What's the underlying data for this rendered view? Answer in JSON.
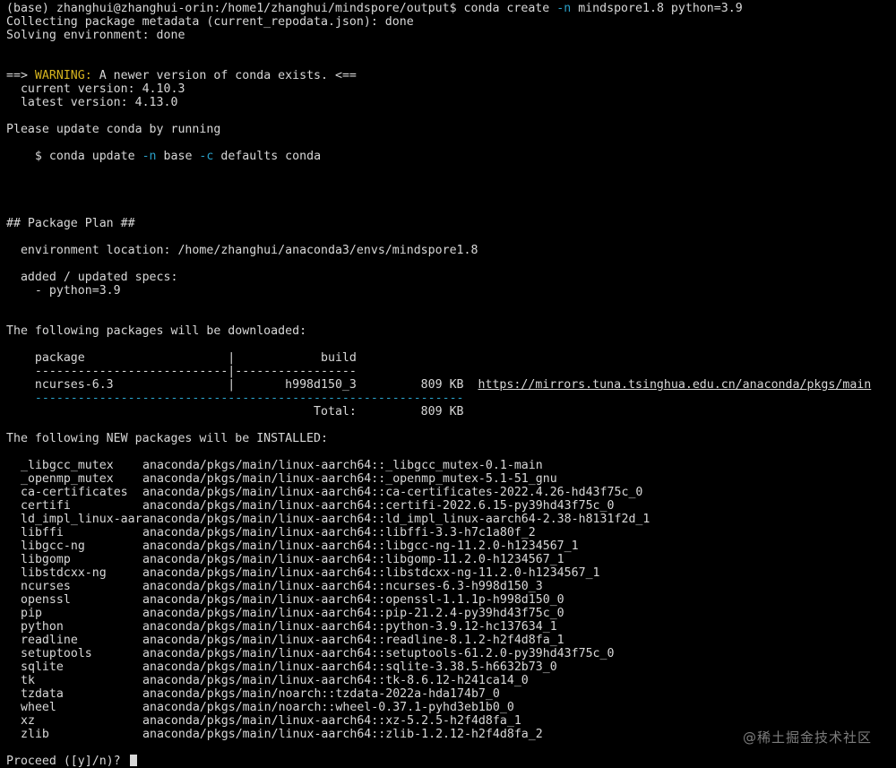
{
  "prompt": {
    "prefix": "(base) zhanghui@zhanghui-orin:/home1/zhanghui/mindspore/output$ conda create ",
    "flag_n": "-n",
    "args": " mindspore1.8 python=3.9"
  },
  "status_lines": [
    "Collecting package metadata (current_repodata.json): done",
    "Solving environment: done"
  ],
  "warning": {
    "arrow_open": "==> ",
    "label": "WARNING:",
    "text": " A newer version of conda exists. <==",
    "current_version": "  current version: 4.10.3",
    "latest_version": "  latest version: 4.13.0"
  },
  "update": {
    "please": "Please update conda by running",
    "cmd_pre": "    $ conda update ",
    "flag_n": "-n",
    "cmd_mid": " base ",
    "flag_c": "-c",
    "cmd_post": " defaults conda"
  },
  "plan": {
    "heading": "## Package Plan ##",
    "env_location": "  environment location: /home/zhanghui/anaconda3/envs/mindspore1.8",
    "specs_label": "  added / updated specs:",
    "spec_item": "    - python=3.9"
  },
  "download": {
    "heading": "The following packages will be downloaded:",
    "header": "    package                    |            build",
    "rule": "    ---------------------------|-----------------",
    "row_name": "    ncurses-6.3                |       h998d150_3         809 KB  ",
    "row_url": "https://mirrors.tuna.tsinghua.edu.cn/anaconda/pkgs/main",
    "rule2": "    ------------------------------------------------------------",
    "total": "                                           Total:         809 KB"
  },
  "install": {
    "heading": "The following NEW packages will be INSTALLED:",
    "packages": [
      {
        "name": "_libgcc_mutex",
        "spec": "anaconda/pkgs/main/linux-aarch64::_libgcc_mutex-0.1-main"
      },
      {
        "name": "_openmp_mutex",
        "spec": "anaconda/pkgs/main/linux-aarch64::_openmp_mutex-5.1-51_gnu"
      },
      {
        "name": "ca-certificates",
        "spec": "anaconda/pkgs/main/linux-aarch64::ca-certificates-2022.4.26-hd43f75c_0"
      },
      {
        "name": "certifi",
        "spec": "anaconda/pkgs/main/linux-aarch64::certifi-2022.6.15-py39hd43f75c_0"
      },
      {
        "name": "ld_impl_linux-aar~",
        "spec": "anaconda/pkgs/main/linux-aarch64::ld_impl_linux-aarch64-2.38-h8131f2d_1"
      },
      {
        "name": "libffi",
        "spec": "anaconda/pkgs/main/linux-aarch64::libffi-3.3-h7c1a80f_2"
      },
      {
        "name": "libgcc-ng",
        "spec": "anaconda/pkgs/main/linux-aarch64::libgcc-ng-11.2.0-h1234567_1"
      },
      {
        "name": "libgomp",
        "spec": "anaconda/pkgs/main/linux-aarch64::libgomp-11.2.0-h1234567_1"
      },
      {
        "name": "libstdcxx-ng",
        "spec": "anaconda/pkgs/main/linux-aarch64::libstdcxx-ng-11.2.0-h1234567_1"
      },
      {
        "name": "ncurses",
        "spec": "anaconda/pkgs/main/linux-aarch64::ncurses-6.3-h998d150_3"
      },
      {
        "name": "openssl",
        "spec": "anaconda/pkgs/main/linux-aarch64::openssl-1.1.1p-h998d150_0"
      },
      {
        "name": "pip",
        "spec": "anaconda/pkgs/main/linux-aarch64::pip-21.2.4-py39hd43f75c_0"
      },
      {
        "name": "python",
        "spec": "anaconda/pkgs/main/linux-aarch64::python-3.9.12-hc137634_1"
      },
      {
        "name": "readline",
        "spec": "anaconda/pkgs/main/linux-aarch64::readline-8.1.2-h2f4d8fa_1"
      },
      {
        "name": "setuptools",
        "spec": "anaconda/pkgs/main/linux-aarch64::setuptools-61.2.0-py39hd43f75c_0"
      },
      {
        "name": "sqlite",
        "spec": "anaconda/pkgs/main/linux-aarch64::sqlite-3.38.5-h6632b73_0"
      },
      {
        "name": "tk",
        "spec": "anaconda/pkgs/main/linux-aarch64::tk-8.6.12-h241ca14_0"
      },
      {
        "name": "tzdata",
        "spec": "anaconda/pkgs/main/noarch::tzdata-2022a-hda174b7_0"
      },
      {
        "name": "wheel",
        "spec": "anaconda/pkgs/main/noarch::wheel-0.37.1-pyhd3eb1b0_0"
      },
      {
        "name": "xz",
        "spec": "anaconda/pkgs/main/linux-aarch64::xz-5.2.5-h2f4d8fa_1"
      },
      {
        "name": "zlib",
        "spec": "anaconda/pkgs/main/linux-aarch64::zlib-1.2.12-h2f4d8fa_2"
      }
    ]
  },
  "proceed": "Proceed ([y]/n)? ",
  "watermark": "@稀土掘金技术社区",
  "colors": {
    "background": "#000000",
    "text": "#d8d8d8",
    "flag": "#2aa0c8",
    "warning": "#d6b41e"
  }
}
